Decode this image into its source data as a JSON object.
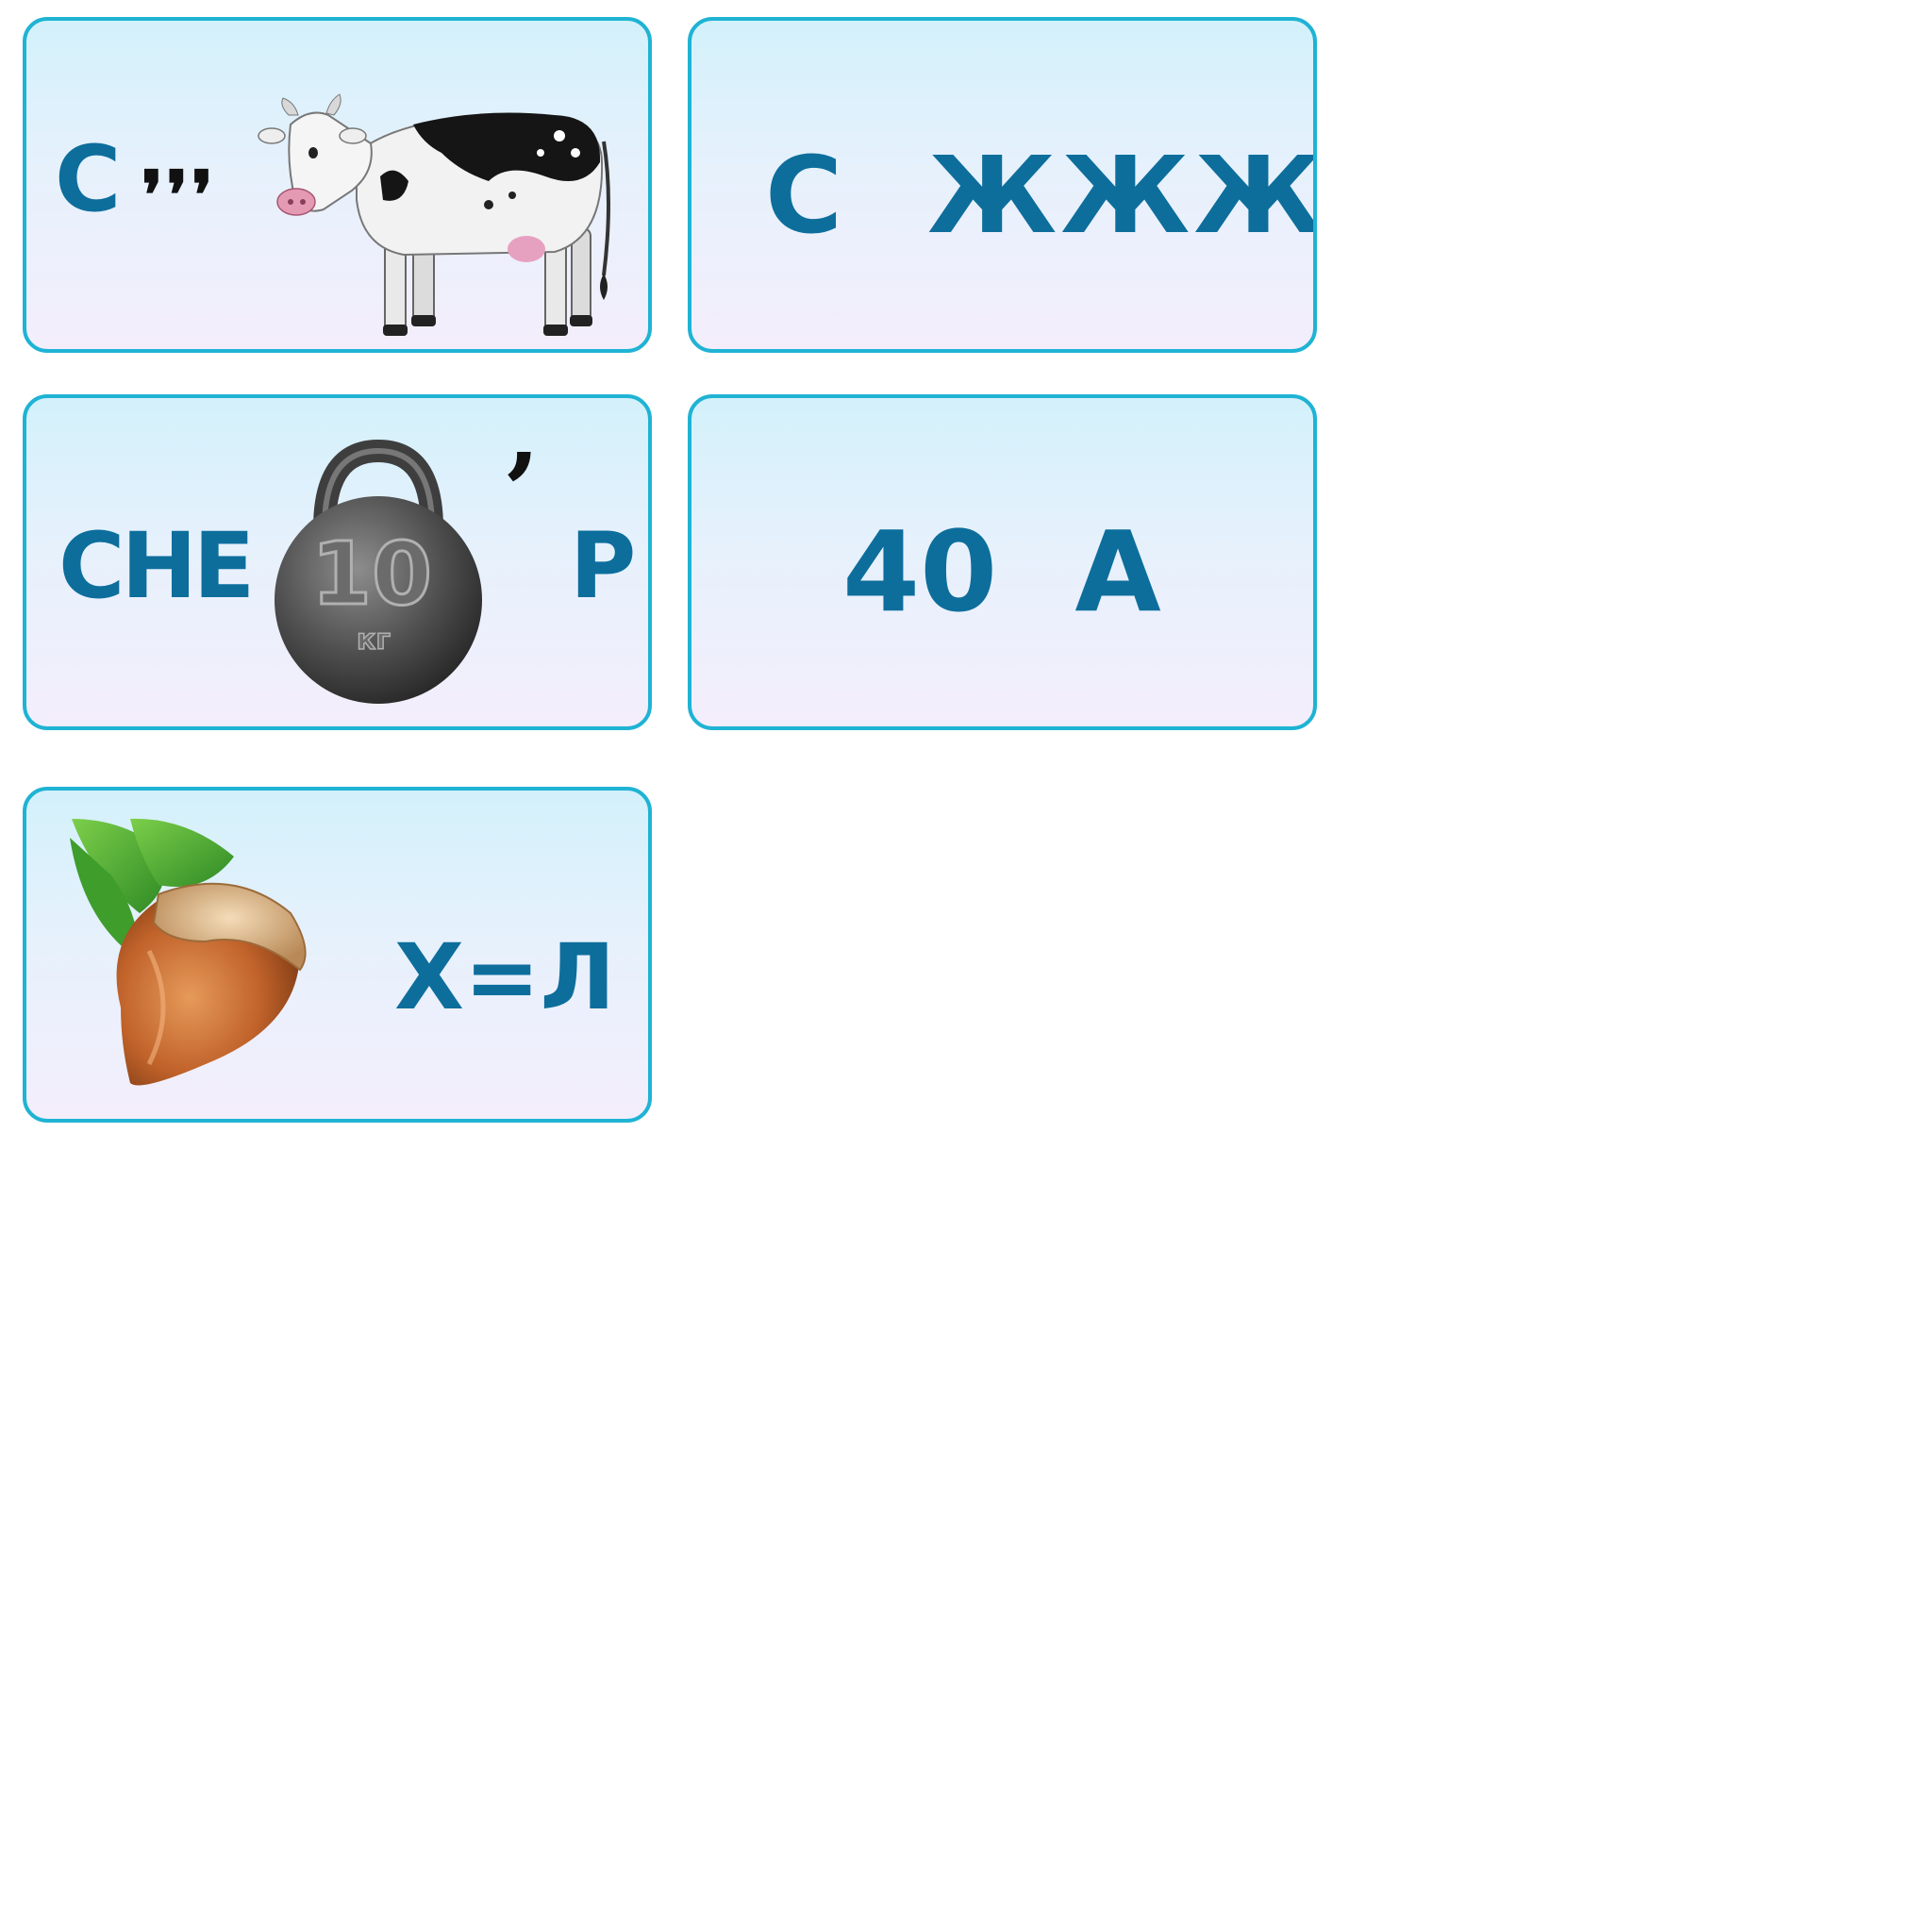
{
  "cards": [
    {
      "letter": "С",
      "commas": "❜❜❜",
      "picture": "cow-icon",
      "colors": {
        "text": "#0d6e9c",
        "border": "#1fb3d4"
      }
    },
    {
      "text": "С  ЖЖЖ"
    },
    {
      "prefix": "СНЕ",
      "picture": "weight-icon",
      "weight_label": "10",
      "weight_unit": "кг",
      "comma": "’",
      "suffix": "Р"
    },
    {
      "text": "40  А"
    },
    {
      "picture": "hazelnut-icon",
      "suffix": "Х=Л"
    }
  ]
}
